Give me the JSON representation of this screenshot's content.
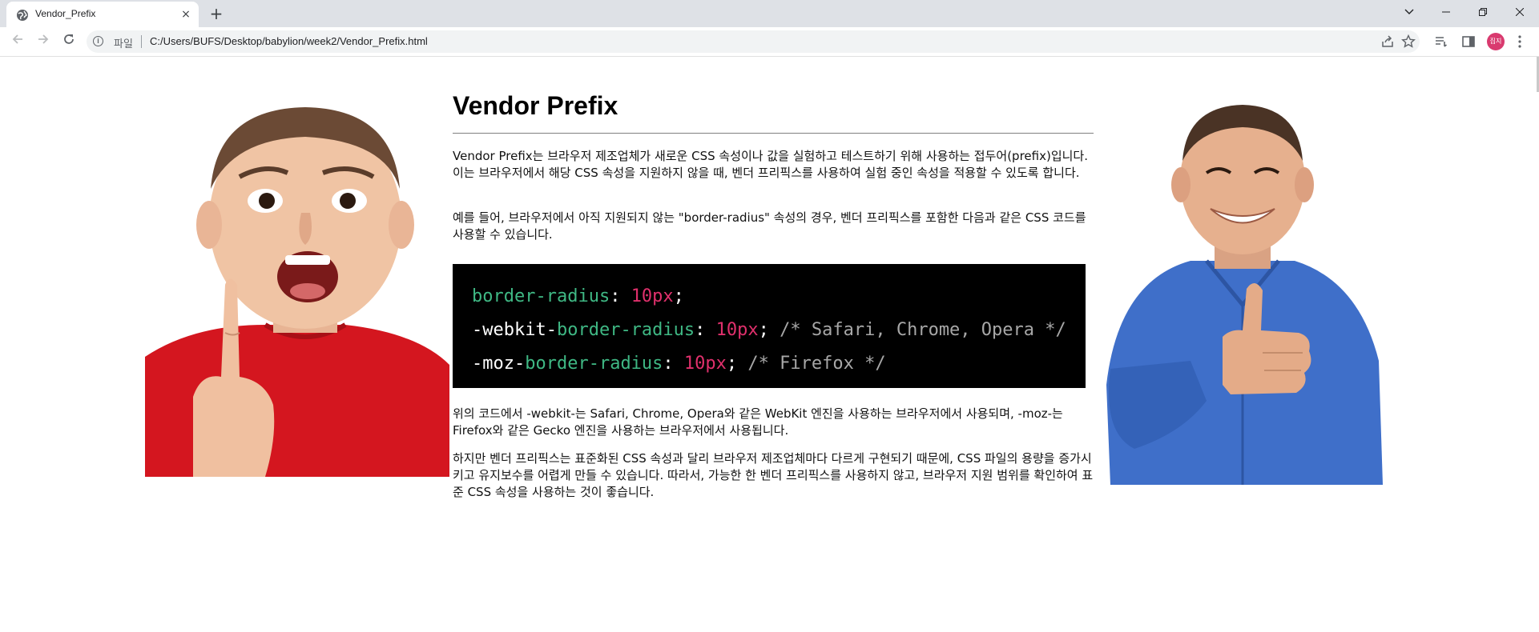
{
  "browser": {
    "tab_title": "Vendor_Prefix",
    "tab_close": "×",
    "new_tab": "+",
    "scheme_label": "파일",
    "url": "C:/Users/BUFS/Desktop/babylion/week2/Vendor_Prefix.html",
    "profile_label": "집지",
    "profile_color": "#d93a6f"
  },
  "page": {
    "title": "Vendor Prefix",
    "paragraphs": [
      "Vendor Prefix는 브라우저 제조업체가 새로운 CSS 속성이나 값을 실험하고 테스트하기 위해 사용하는 접두어(prefix)입니다. 이는 브라우저에서 해당 CSS 속성을 지원하지 않을 때, 벤더 프리픽스를 사용하여 실험 중인 속성을 적용할 수 있도록 합니다.",
      "예를 들어, 브라우저에서 아직 지원되지 않는 \"border-radius\" 속성의 경우, 벤더 프리픽스를 포함한 다음과 같은 CSS 코드를 사용할 수 있습니다.",
      "위의 코드에서 -webkit-는 Safari, Chrome, Opera와 같은 WebKit 엔진을 사용하는 브라우저에서 사용되며, -moz-는 Firefox와 같은 Gecko 엔진을 사용하는 브라우저에서 사용됩니다.",
      "하지만 벤더 프리픽스는 표준화된 CSS 속성과 달리 브라우저 제조업체마다 다르게 구현되기 때문에, CSS 파일의 용량을 증가시키고 유지보수를 어렵게 만들 수 있습니다. 따라서, 가능한 한 벤더 프리픽스를 사용하지 않고, 브라우저 지원 범위를 확인하여 표준 CSS 속성을 사용하는 것이 좋습니다."
    ],
    "code": {
      "line1": {
        "prop": "border-radius",
        "colon": ": ",
        "value": "10px",
        "end": ";"
      },
      "line2": {
        "prefix": "-webkit-",
        "prop": "border-radius",
        "colon": ": ",
        "value": "10px",
        "end": ";",
        "comment": " /* Safari, Chrome, Opera */"
      },
      "line3": {
        "prefix": "-moz-",
        "prop": "border-radius",
        "colon": ": ",
        "value": "10px",
        "end": ";",
        "comment": " /* Firefox */"
      },
      "colors": {
        "background": "#000000",
        "property": "#3fb884",
        "number": "#e0306c",
        "comment": "#a7a7a7",
        "text": "#ffffff"
      }
    },
    "images": {
      "left": "surprised-boy-pointing-up-photo",
      "right": "smiling-boy-thumbs-up-photo"
    }
  }
}
